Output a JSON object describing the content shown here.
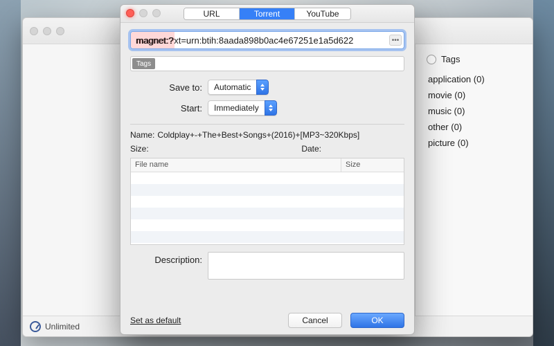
{
  "back_window": {
    "statusbar_text": "Unlimited"
  },
  "sidebar": {
    "radio_label": "Tags",
    "tags": [
      {
        "label": "application (0)"
      },
      {
        "label": "movie (0)"
      },
      {
        "label": "music (0)"
      },
      {
        "label": "other (0)"
      },
      {
        "label": "picture (0)"
      }
    ]
  },
  "modal": {
    "tabs": [
      {
        "label": "URL",
        "active": false
      },
      {
        "label": "Torrent",
        "active": true
      },
      {
        "label": "YouTube",
        "active": false
      }
    ],
    "url_value": "magnet:?xt=urn:btih:8aada898b0ac4e67251e1a5d622",
    "url_highlight": "magnet:?",
    "tags_chip": "Tags",
    "fields": {
      "save_to_label": "Save to:",
      "save_to_value": "Automatic",
      "start_label": "Start:",
      "start_value": "Immediately"
    },
    "info": {
      "name_label": "Name:",
      "name_value": "Coldplay+-+The+Best+Songs+(2016)+[MP3~320Kbps]",
      "size_label": "Size:",
      "size_value": "",
      "date_label": "Date:",
      "date_value": ""
    },
    "table": {
      "col_name": "File name",
      "col_size": "Size"
    },
    "description_label": "Description:",
    "set_default": "Set as default",
    "cancel": "Cancel",
    "ok": "OK"
  }
}
